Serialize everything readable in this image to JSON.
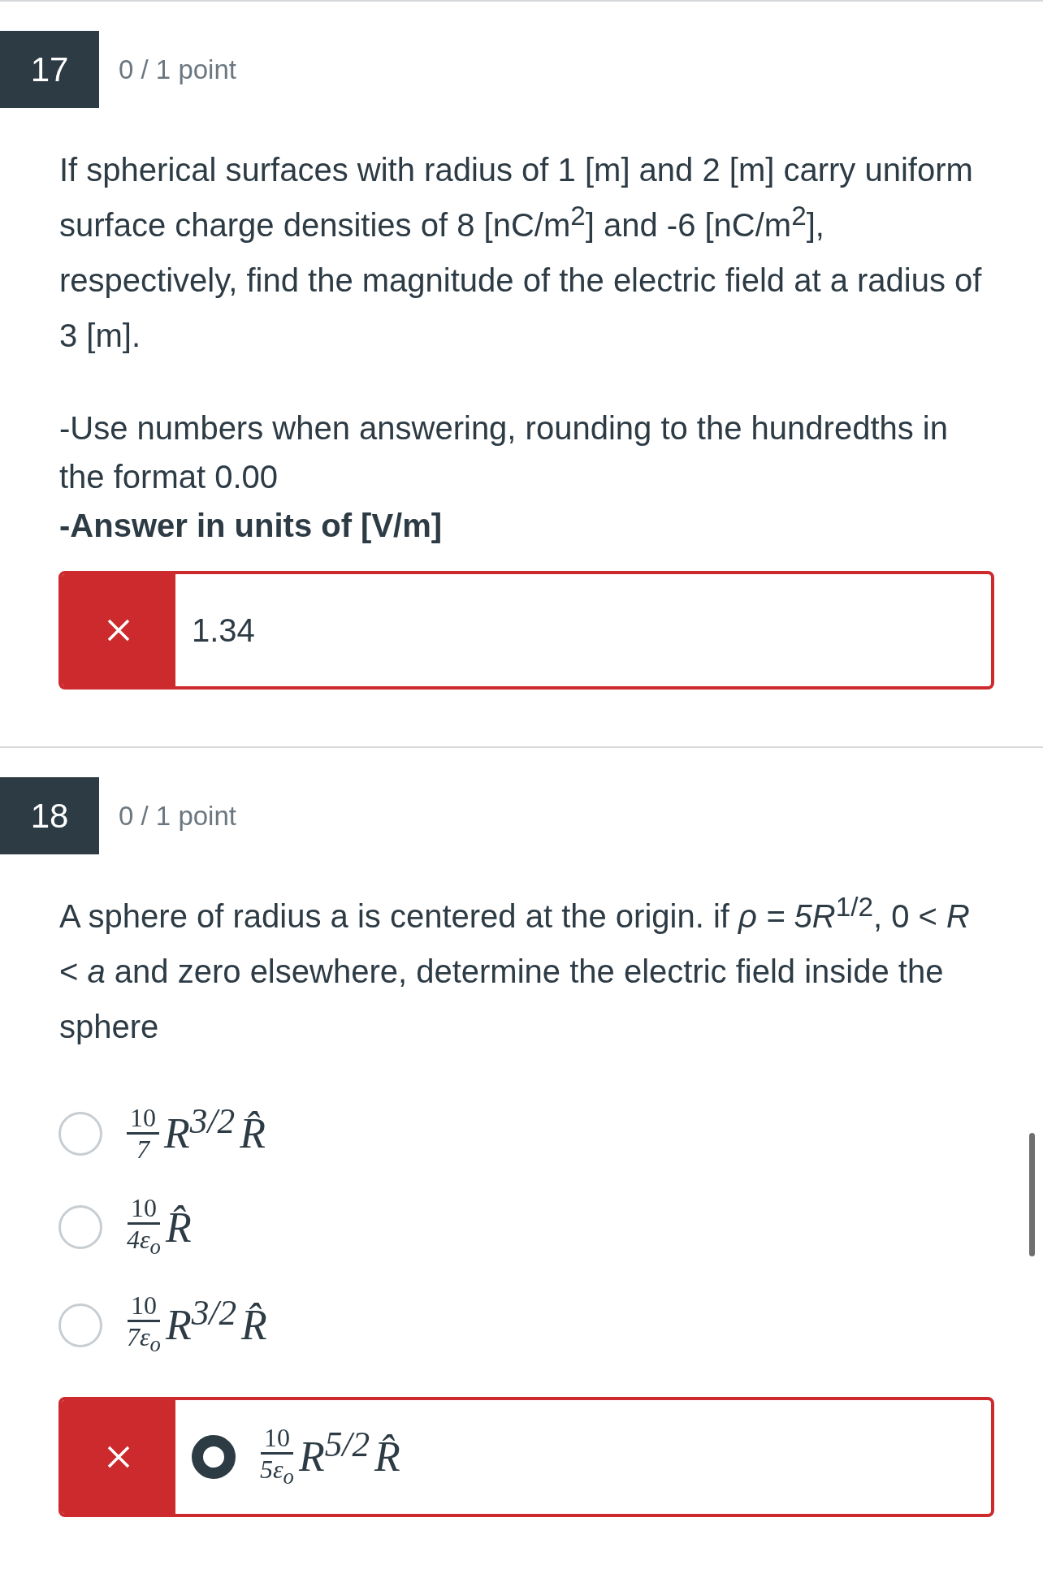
{
  "questions": [
    {
      "number": "17",
      "points": "0 / 1 point",
      "kind": "numeric",
      "prompt": "If spherical surfaces with radius of 1 [m] and 2 [m] carry uniform surface charge densities of 8 [nC/m$^{2}$] and -6 [nC/m$^{2}$], respectively, find the magnitude of the electric field at a radius of 3 [m].",
      "notes": [
        {
          "text": "-Use numbers when answering, rounding to the hundredths in the format 0.00",
          "bold": false
        },
        {
          "text": "-Answer in units of [V/m]",
          "bold": true
        }
      ],
      "answer": {
        "value": "1.34",
        "correct": false
      }
    },
    {
      "number": "18",
      "points": "0 / 1 point",
      "kind": "choice",
      "prompt": "A sphere of radius a is centered at the origin. if *ρ = 5R*$^{1/2}$, 0 < *R* < *a* and zero elsewhere, determine the electric field inside the sphere",
      "options": [
        {
          "numerator": "10",
          "denominator": "7",
          "power": "R$^{3/2}$",
          "vector": "R̂",
          "selected": false
        },
        {
          "numerator": "10",
          "denominator": "4ε$_{o}$",
          "vector": "R̂",
          "selected": false
        },
        {
          "numerator": "10",
          "denominator": "7ε$_{o}$",
          "power": "R$^{3/2}$",
          "vector": "R̂",
          "selected": false
        },
        {
          "numerator": "10",
          "denominator": "5ε$_{o}$",
          "power": "R$^{5/2}$",
          "vector": "R̂",
          "selected": true,
          "correct": false
        }
      ]
    }
  ]
}
